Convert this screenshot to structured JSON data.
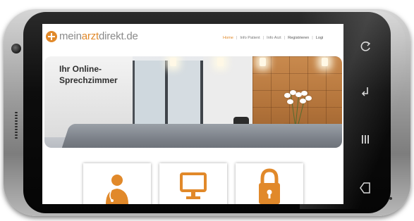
{
  "site": {
    "logo": {
      "part1": "mein",
      "part2": "arzt",
      "part3": "direkt",
      "suffix": ".de"
    },
    "nav": [
      {
        "label": "Home"
      },
      {
        "label": "Info Patient"
      },
      {
        "label": "Info Arzt"
      },
      {
        "label": "Registrieren"
      },
      {
        "label": "Logi"
      }
    ],
    "hero": {
      "title": "Ihr Online-Sprechzimmer"
    },
    "tiles": [
      {
        "icon": "doctor-icon"
      },
      {
        "icon": "monitor-icon"
      },
      {
        "icon": "padlock-icon"
      }
    ]
  },
  "device": {
    "nav_buttons": [
      "recent-apps-icon",
      "back-icon",
      "menu-icon",
      "home-icon"
    ]
  },
  "colors": {
    "accent": "#e1892a",
    "logo_grey": "#8a8a8a",
    "hero_text": "#2f2f2f",
    "bezel": "#0d0d0d"
  }
}
